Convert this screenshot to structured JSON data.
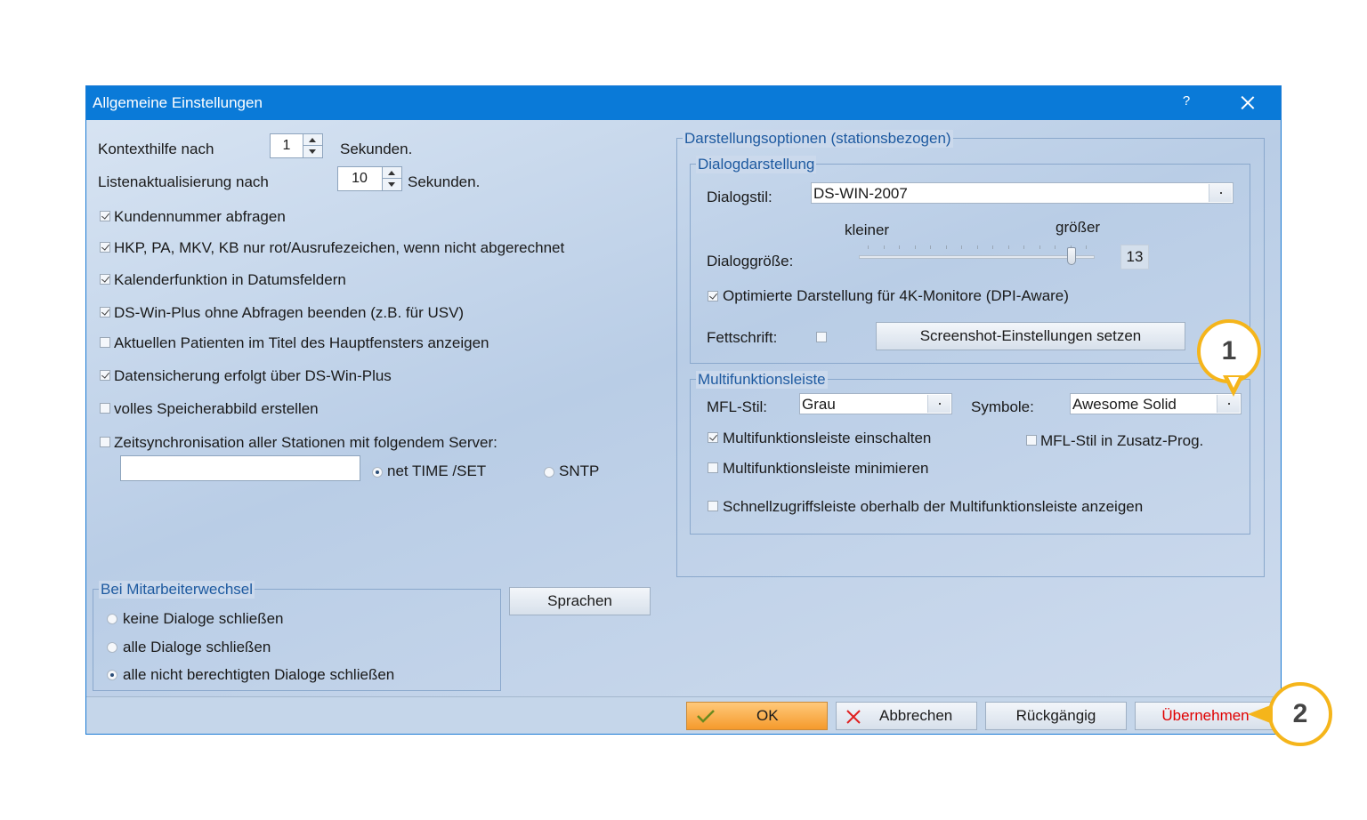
{
  "window": {
    "title": "Allgemeine Einstellungen",
    "help": "?"
  },
  "left": {
    "kontexthilfe": {
      "label": "Kontexthilfe nach",
      "value": "1",
      "unit": "Sekunden."
    },
    "listenaktualisierung": {
      "label": "Listenaktualisierung nach",
      "value": "10",
      "unit": "Sekunden."
    },
    "checkboxes": [
      {
        "label": "Kundennummer abfragen",
        "checked": true
      },
      {
        "label": "HKP, PA, MKV, KB nur rot/Ausrufezeichen, wenn nicht abgerechnet",
        "checked": true
      },
      {
        "label": "Kalenderfunktion in Datumsfeldern",
        "checked": true
      },
      {
        "label": "DS-Win-Plus ohne Abfragen beenden (z.B. für USV)",
        "checked": true
      },
      {
        "label": "Aktuellen Patienten im Titel des Hauptfensters anzeigen",
        "checked": false
      },
      {
        "label": "Datensicherung erfolgt über DS-Win-Plus",
        "checked": true
      },
      {
        "label": "volles Speicherabbild erstellen",
        "checked": false
      }
    ],
    "zeitsync": {
      "label": "Zeitsynchronisation aller Stationen mit folgendem Server:",
      "server_value": "",
      "option1": "net TIME /SET",
      "option2": "SNTP"
    },
    "mitarbeiter": {
      "title": "Bei Mitarbeiterwechsel",
      "options": [
        "keine Dialoge schließen",
        "alle Dialoge schließen",
        "alle nicht berechtigten Dialoge schließen"
      ],
      "selected": 2
    },
    "sprachen_button": "Sprachen"
  },
  "right": {
    "title": "Darstellungsoptionen (stationsbezogen)",
    "dialogdarstellung": {
      "title": "Dialogdarstellung",
      "dialogstil_label": "Dialogstil:",
      "dialogstil_value": "DS-WIN-2007",
      "kleiner": "kleiner",
      "groesser": "größer",
      "dialoggroesse_label": "Dialoggröße:",
      "dialoggroesse_value": "13",
      "slider_fraction": 0.9,
      "dpi_label": "Optimierte Darstellung für 4K-Monitore (DPI-Aware)",
      "fettschrift_label": "Fettschrift:",
      "screenshot_button": "Screenshot-Einstellungen setzen"
    },
    "mfl": {
      "title": "Multifunktionsleiste",
      "stil_label": "MFL-Stil:",
      "stil_value": "Grau",
      "symbole_label": "Symbole:",
      "symbole_value": "Awesome Solid",
      "einschalten": "Multifunktionsleiste einschalten",
      "zusatz": "MFL-Stil in Zusatz-Prog.",
      "minimieren": "Multifunktionsleiste minimieren",
      "schnellzugriff": "Schnellzugriffsleiste oberhalb der Multifunktionsleiste anzeigen"
    }
  },
  "buttons": {
    "ok": "OK",
    "abbrechen": "Abbrechen",
    "rueckgaengig": "Rückgängig",
    "uebernehmen": "Übernehmen"
  },
  "callouts": {
    "one": "1",
    "two": "2"
  },
  "colors": {
    "titlebar": "#0a7ad8",
    "callout": "#f5b51b",
    "ok": "#f59a2c",
    "apply_text": "#e00000"
  }
}
